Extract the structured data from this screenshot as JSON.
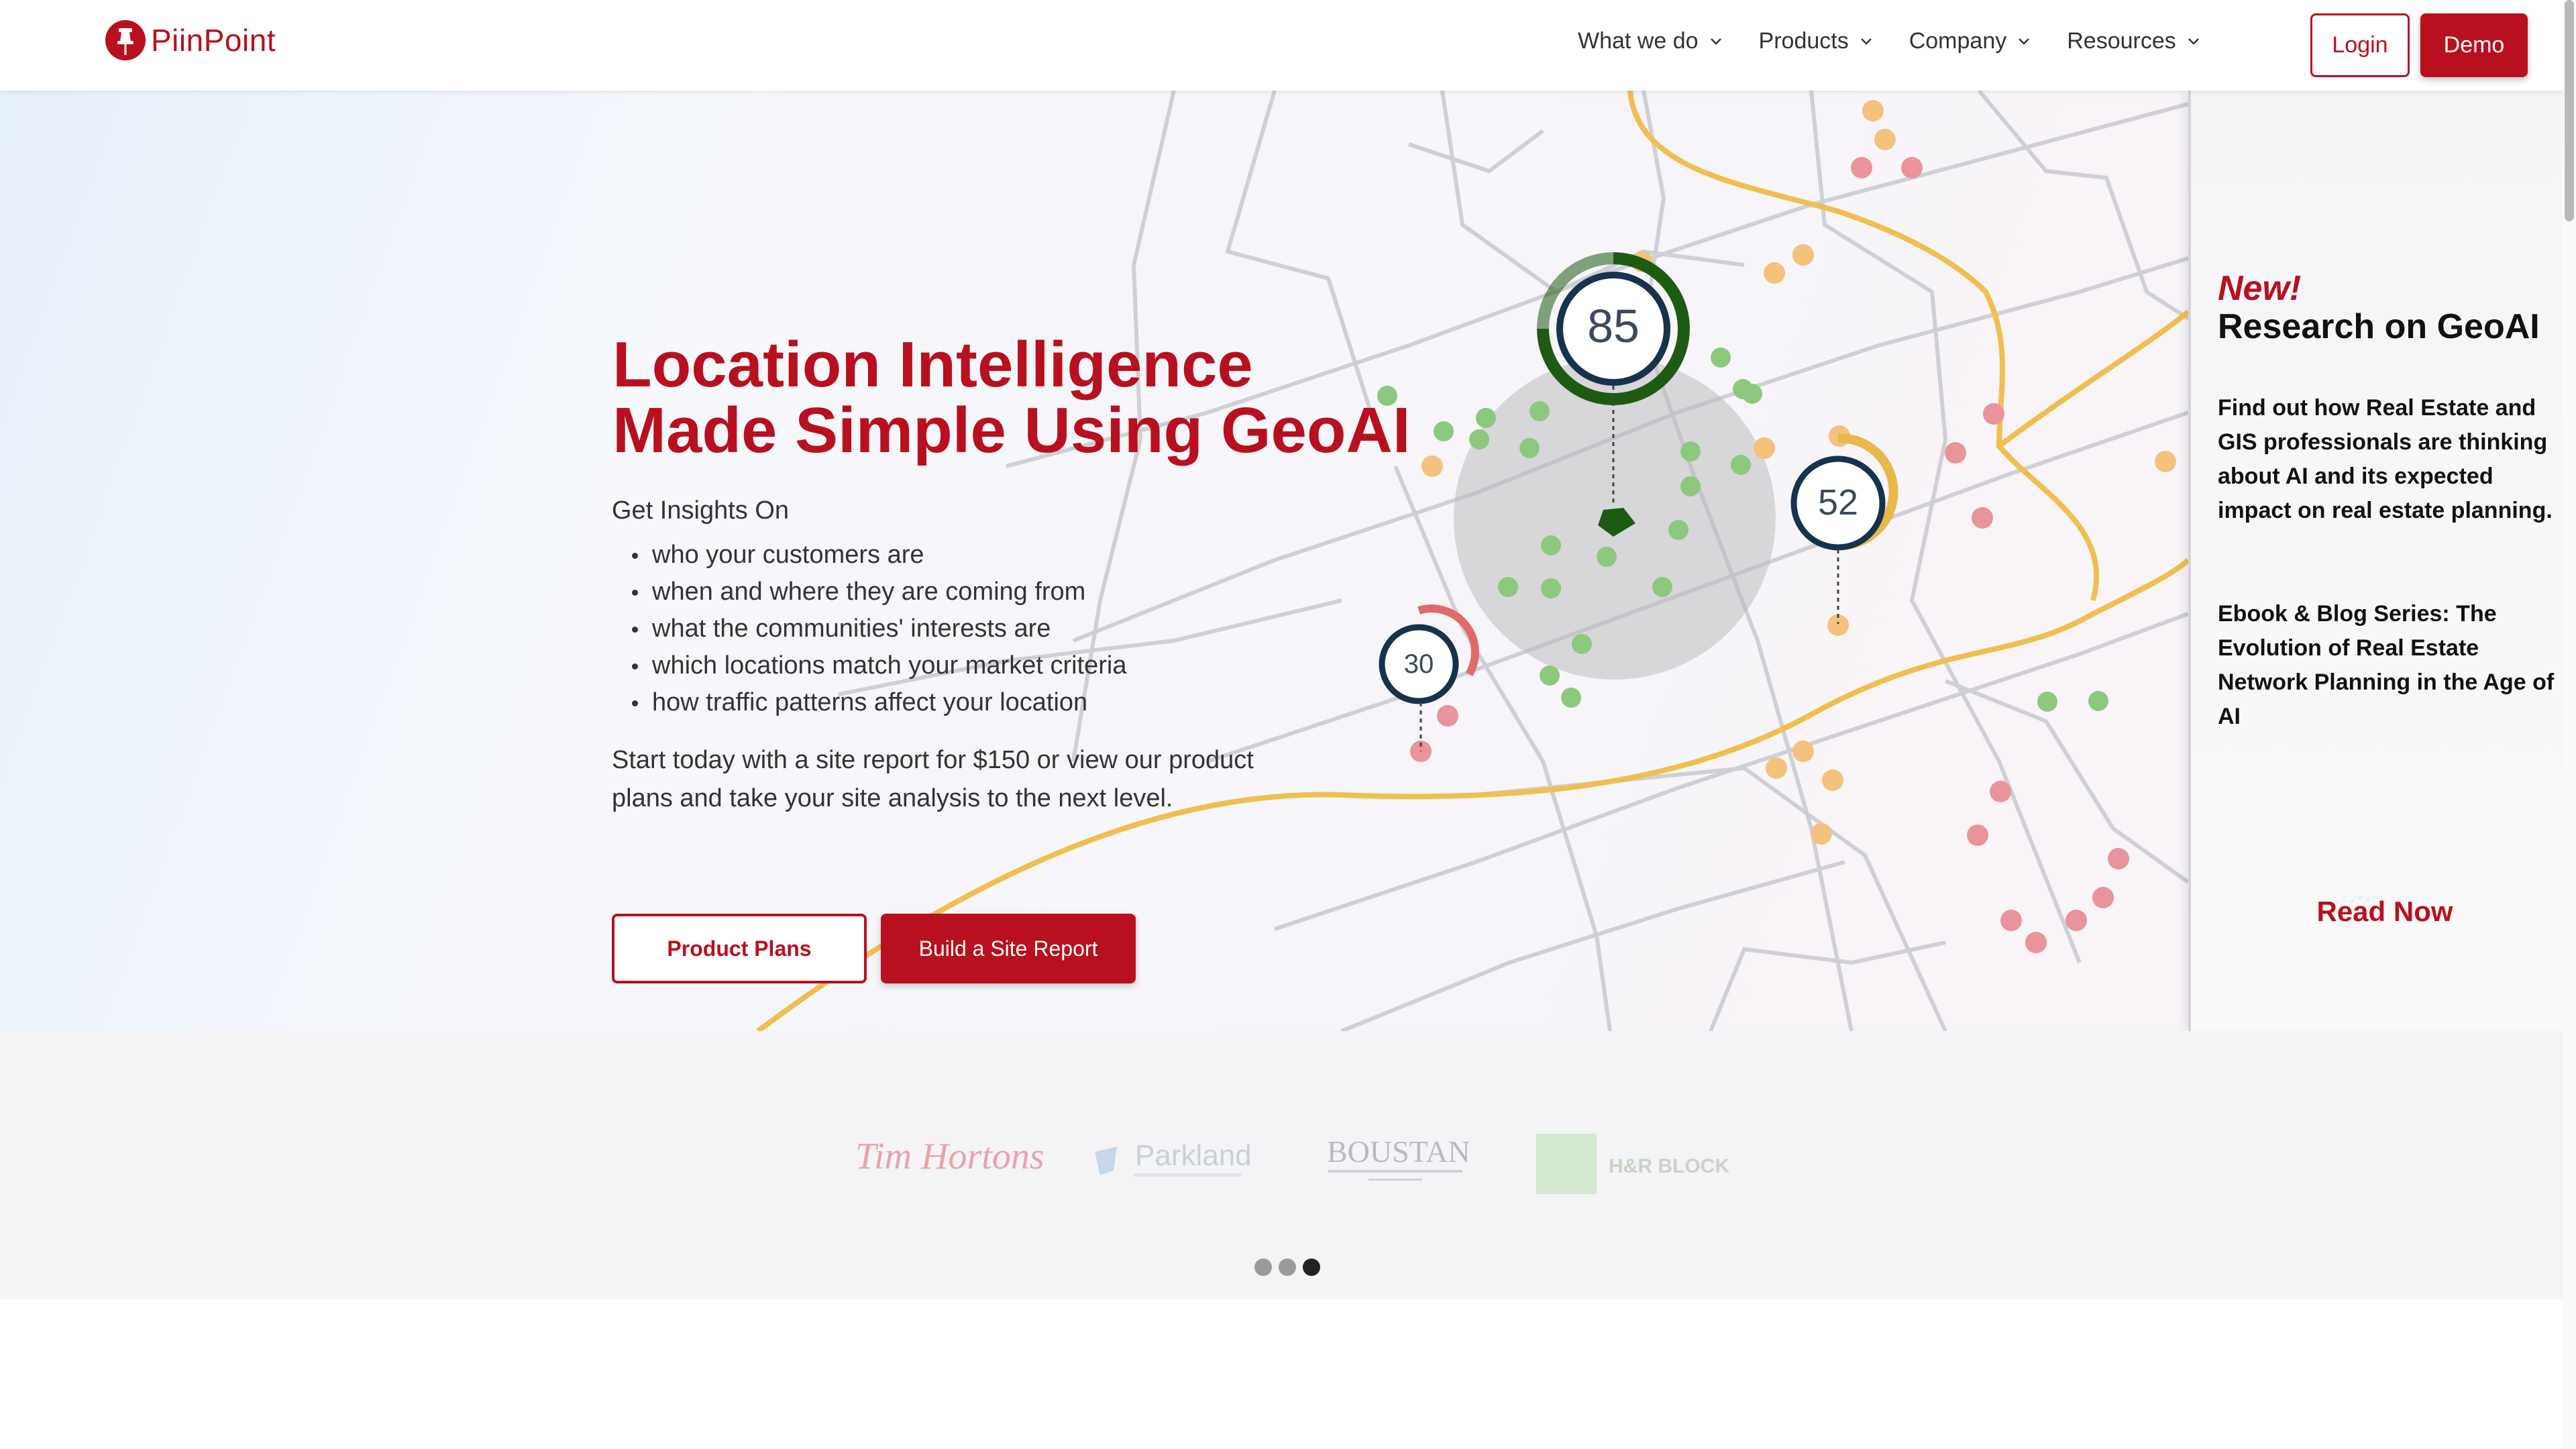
{
  "header": {
    "logo_text": "PiinPoint",
    "nav": [
      {
        "label": "What we do"
      },
      {
        "label": "Products"
      },
      {
        "label": "Company"
      },
      {
        "label": "Resources"
      }
    ],
    "login_label": "Login",
    "demo_label": "Demo"
  },
  "hero": {
    "title_line1": "Location Intelligence",
    "title_line2": "Made Simple Using GeoAI",
    "insights_label": "Get Insights On",
    "insights": [
      "who your customers are",
      "when and where they are coming from",
      "what the communities' interests are",
      "which locations match your market criteria",
      "how traffic patterns affect your location"
    ],
    "description": "Start today with a site report for $150 or view our product plans and take your site analysis to the next level.",
    "plans_button": "Product Plans",
    "report_button": "Build a Site Report"
  },
  "map": {
    "scores": [
      {
        "value": "85",
        "color": "#1e5b12"
      },
      {
        "value": "52",
        "color": "#e8b84a"
      },
      {
        "value": "30",
        "color": "#e06a6a"
      }
    ],
    "colors": {
      "route": "#f0bf4f",
      "roads": "#c9c9cf",
      "green": "#8cc97e",
      "orange": "#f3c27c",
      "red": "#e8949a"
    }
  },
  "side_panel": {
    "new_label": "New!",
    "title": "Research on GeoAI",
    "description": "Find out how Real Estate and GIS professionals are thinking about AI and its expected impact on real estate planning.",
    "series": "Ebook & Blog Series: The Evolution of Real Estate Network Planning in the Age of AI",
    "read_now": "Read Now"
  },
  "logos": {
    "items": [
      "Tim Hortons",
      "Parkland",
      "BOUSTAN",
      "H&R BLOCK"
    ],
    "carousel_pages": 3,
    "active_page": 3
  },
  "colors": {
    "brand": "#b8101f"
  }
}
